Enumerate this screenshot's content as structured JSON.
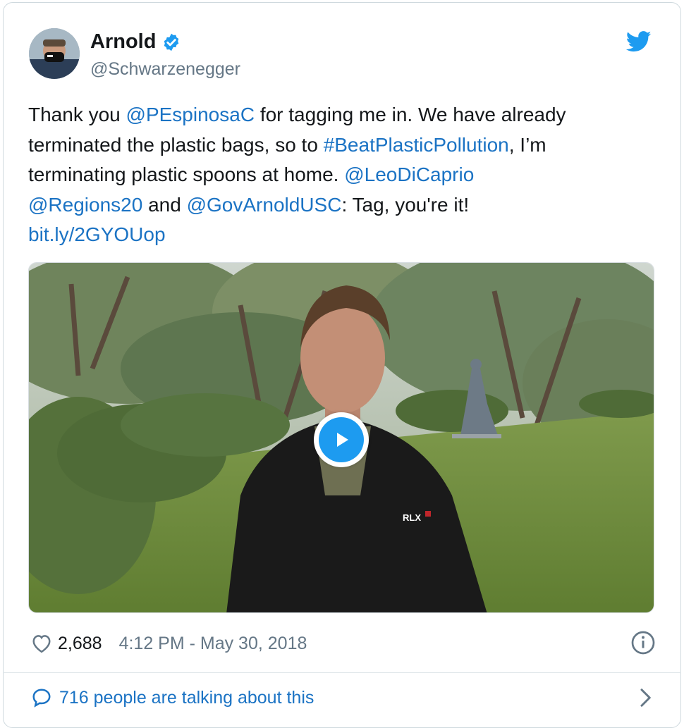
{
  "tweet": {
    "author_name": "Arnold",
    "author_handle": "@Schwarzenegger",
    "text": {
      "p1": "Thank you ",
      "mention1": "@PEspinosaC",
      "p2": " for tagging me in. We have already terminated the plastic bags, so to ",
      "hashtag": "#BeatPlasticPollution",
      "p3": ", I’m terminating plastic spoons at home.  ",
      "mention2": "@LeoDiCaprio",
      "mention3": "@Regions20",
      "p4": " and ",
      "mention4": "@GovArnoldUSC",
      "p5": ": Tag, you're it!",
      "link": "bit.ly/2GYOUop"
    },
    "likes": "2,688",
    "timestamp": "4:12 PM - May 30, 2018",
    "talking": "716 people are talking about this"
  },
  "icons": [
    "verified-badge-icon",
    "twitter-bird-icon",
    "play-icon",
    "heart-icon",
    "info-icon",
    "speech-bubble-icon",
    "chevron-right-icon"
  ],
  "colors": {
    "link": "#1b73c4",
    "twitter_blue": "#1d9bf0",
    "text": "#14171a",
    "secondary": "#657786"
  }
}
